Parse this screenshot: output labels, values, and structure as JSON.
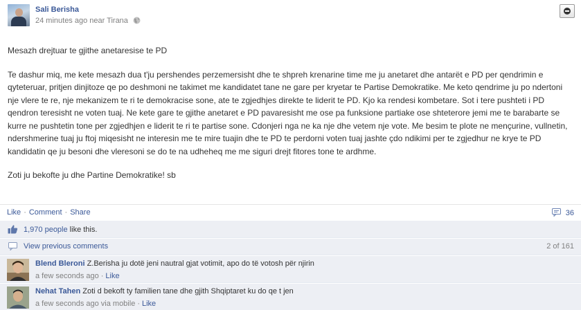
{
  "post": {
    "author": "Sali Berisha",
    "time": "24 minutes ago near Tirana",
    "paragraphs": [
      "Mesazh drejtuar te gjithe anetaresise te PD",
      "Te dashur miq, me kete mesazh dua t'ju pershendes perzemersisht dhe te shpreh krenarine time me ju anetaret dhe antarët e PD per qendrimin e qyteteruar, pritjen dinjitoze qe po deshmoni ne takimet me kandidatet tane ne gare per kryetar te Partise Demokratike. Me keto qendrime ju po ndertoni nje vlere te re, nje mekanizem te ri te demokracise sone, ate te zgjedhjes direkte te liderit te PD. Kjo ka rendesi kombetare. Sot i tere pushteti i PD qendron teresisht ne voten tuaj. Ne kete gare te gjithe anetaret e PD pavaresisht me ose pa funksione partiake ose shteterore jemi me te barabarte se kurre ne pushtetin tone per zgjedhjen e liderit te ri te partise sone. Cdonjeri nga ne ka nje dhe vetem nje vote. Me besim te plote ne mençurine, vullnetin, ndershmerine tuaj ju ftoj miqesisht ne interesin me te mire tuajin dhe te PD te perdorni voten tuaj jashte çdo ndikimi per te zgjedhur ne krye te PD kandidatin qe ju besoni dhe vleresoni se do te na udheheq me me siguri drejt fitores tone te ardhme.",
      "Zoti ju bekofte ju dhe Partine Demokratike! sb"
    ]
  },
  "actions": {
    "like": "Like",
    "comment": "Comment",
    "share": "Share",
    "sep": "·",
    "comment_count": "36"
  },
  "likes": {
    "count_link": "1,970 people",
    "suffix": " like this."
  },
  "view_previous": {
    "label": "View previous comments",
    "pager": "2 of 161"
  },
  "comments": [
    {
      "name": "Blend Bleroni",
      "text": " Z.Berisha ju dotë jeni nautral gjat votimit, apo do të votosh për njirin",
      "time": "a few seconds ago",
      "like": "Like"
    },
    {
      "name": "Nehat Tahen",
      "text": " Zoti d bekoft ty familien tane dhe gjith Shqiptaret ku do qe t jen",
      "time": "a few seconds ago via mobile",
      "like": "Like"
    }
  ],
  "colors": {
    "link": "#3b5998",
    "ufi_background": "#edeff4",
    "meta_text": "#808080"
  },
  "icons": {
    "globe": "globe-icon",
    "menu": "options-menu-icon",
    "comment": "comment-bubble-icon",
    "like": "thumbs-up-icon",
    "view_previous": "comments-icon"
  }
}
